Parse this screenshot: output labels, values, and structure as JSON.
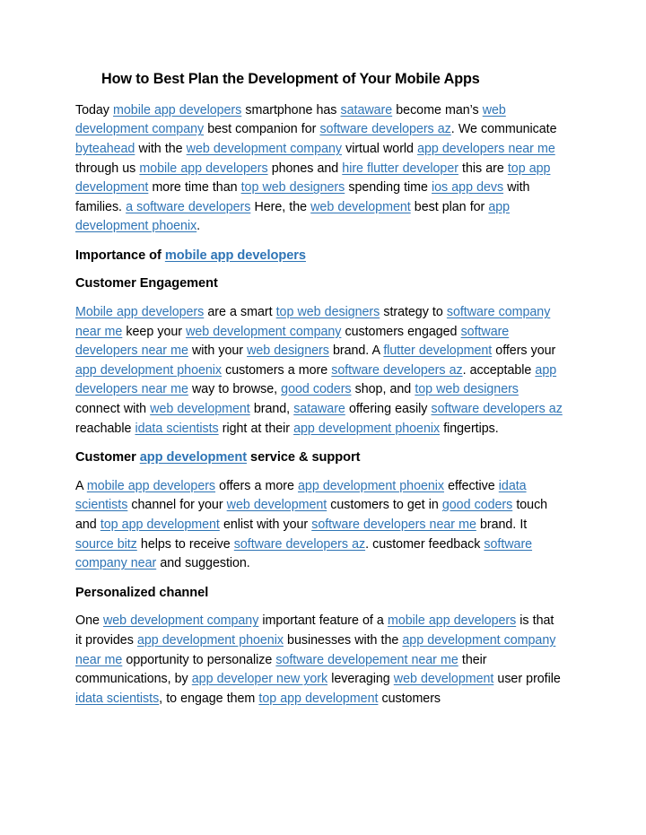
{
  "document": {
    "title": "How to Best Plan the Development of Your Mobile Apps",
    "link_color": "#2E74B5",
    "text_color": "#000000",
    "background": "#ffffff"
  },
  "intro": {
    "t1": "Today ",
    "l1": "mobile app developers",
    "t2": " smartphone has ",
    "l2": "sataware",
    "t3": " become man’s ",
    "l3": "web development company",
    "t4": " best companion for ",
    "l4": "software developers az",
    "t5": ". We communicate ",
    "l5": "byteahead",
    "t6": " with the ",
    "l6": "web development company",
    "t7": " virtual world ",
    "l7": "app developers near me",
    "t8": " through us ",
    "l8": "mobile app developers",
    "t9": " phones and ",
    "l9": "hire flutter developer",
    "t10": " this are ",
    "l10": "top app development",
    "t11": " more time than ",
    "l11": "top web designers",
    "t12": " spending time ",
    "l12": "ios app devs",
    "t13": " with families. ",
    "l13": "a software developers",
    "t14": " Here, the ",
    "l14": "web development",
    "t15": " best plan for ",
    "l15": "app development phoenix",
    "t16": "."
  },
  "importance_heading": {
    "t1": "Importance of ",
    "l1": "mobile app developers"
  },
  "customer_engagement": {
    "heading": "Customer Engagement",
    "l1": "Mobile app developers",
    "t1": " are a smart ",
    "l2": "top web designers",
    "t2": " strategy to ",
    "l3": "software company near me",
    "t3": " keep your ",
    "l4": "web development company",
    "t4": " customers engaged ",
    "l5": "software developers near me",
    "t5": " with your ",
    "l6": "web designers",
    "t6": " brand. A ",
    "l7": "flutter development",
    "t7": " offers your ",
    "l8": "app development phoenix",
    "t8": " customers a more ",
    "l9": "software developers az",
    "t9": ". acceptable ",
    "l10": "app developers near me",
    "t10": " way to browse, ",
    "l11": "good coders",
    "t11": " shop, and ",
    "l12": "top web designers",
    "t12": " connect with ",
    "l13": "web development",
    "t13": " brand, ",
    "l14": "sataware",
    "t14": " offering easily ",
    "l15": "software developers az",
    "t15": " reachable ",
    "l16": "idata scientists",
    "t16": " right at their  ",
    "l17": "app development phoenix",
    "t17": " fingertips."
  },
  "customer_service_heading": {
    "t1": "Customer ",
    "l1": "app development",
    "t2": " service & support"
  },
  "customer_service": {
    "t1": "A ",
    "l1": "mobile app developers",
    "t2": " offers a more ",
    "l2": "app development phoenix",
    "t3": " effective ",
    "l3": "idata scientists",
    "t4": " channel for your ",
    "l4": "web development",
    "t5": " customers to get in ",
    "l5": "good coders",
    "t6": " touch and ",
    "l6": "top app development",
    "t7": " enlist with your ",
    "l7": "software developers near me",
    "t8": " brand. It ",
    "l8": "source bitz",
    "t9": " helps to receive ",
    "l9": "software developers az",
    "t10": ". customer feedback ",
    "l10": "software company near",
    "t11": " and suggestion."
  },
  "personalized_heading": {
    "text": "Personalized channel"
  },
  "personalized": {
    "t1": "One ",
    "l1": "web development company",
    "t2": " important feature of a ",
    "l2": "mobile app developers",
    "t3": " is that it provides ",
    "l3": "app development phoenix",
    "t4": " businesses with the ",
    "l4": "app development company near me",
    "t5": " opportunity to personalize ",
    "l5": "software developement near me",
    "t6": " their communications, by ",
    "l6": "app developer new york",
    "t7": " leveraging ",
    "l7": "web development",
    "t8": " user profile ",
    "l8": "idata scientists",
    "t9": ", to engage them ",
    "l9": "top app development",
    "t10": " customers"
  }
}
